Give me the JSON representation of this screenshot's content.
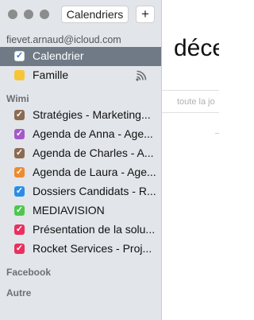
{
  "toolbar": {
    "calendars_button": "Calendriers",
    "add_button": "+"
  },
  "groups": {
    "icloud": {
      "header": "fievet.arnaud@icloud.com",
      "items": [
        {
          "label": "Calendrier",
          "color": "#2a7de1",
          "checked": true,
          "selected": true
        },
        {
          "label": "Famille",
          "color": "#f7c637",
          "checked": false,
          "selected": false,
          "icon": "shared-signal-icon"
        }
      ]
    },
    "wimi": {
      "header": "Wimi",
      "items": [
        {
          "label": "Stratégies - Marketing...",
          "color": "#8b6b51",
          "checked": true
        },
        {
          "label": "Agenda de Anna - Age...",
          "color": "#a558c9",
          "checked": true
        },
        {
          "label": "Agenda de Charles - A...",
          "color": "#8b6b51",
          "checked": true
        },
        {
          "label": "Agenda de Laura - Age...",
          "color": "#ef8a2d",
          "checked": true
        },
        {
          "label": "Dossiers Candidats - R...",
          "color": "#2a8de6",
          "checked": true
        },
        {
          "label": "MEDIAVISION",
          "color": "#4cc94a",
          "checked": true
        },
        {
          "label": "Présentation de la solu...",
          "color": "#e9305e",
          "checked": true
        },
        {
          "label": "Rocket Services - Proj...",
          "color": "#e9305e",
          "checked": true
        }
      ]
    },
    "facebook": {
      "header": "Facebook"
    },
    "other": {
      "header": "Autre"
    }
  },
  "main": {
    "month_title": "déce",
    "all_day_label": "toute la jo"
  }
}
